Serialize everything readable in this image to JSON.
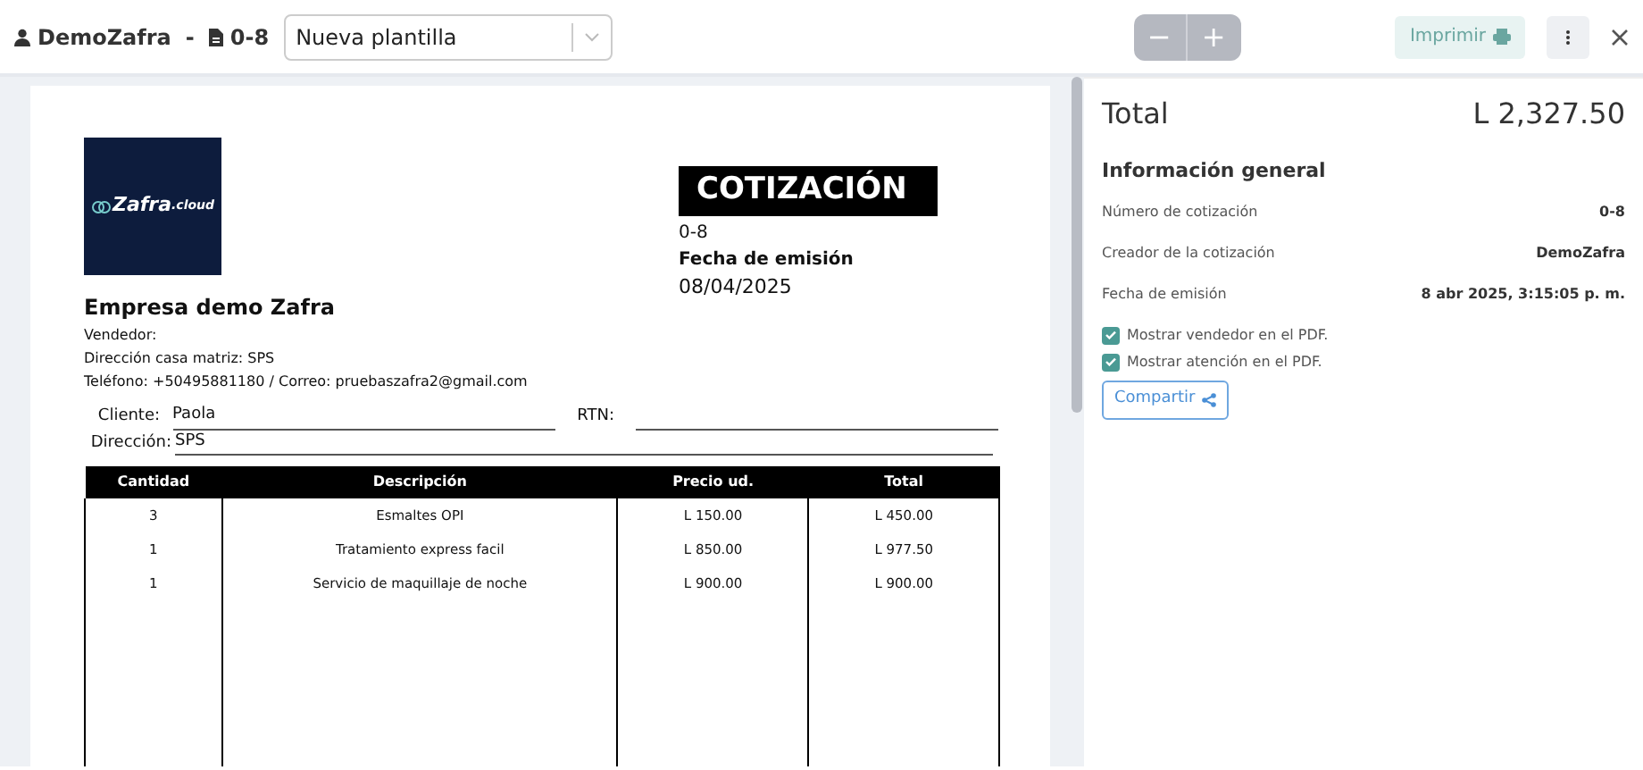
{
  "toolbar": {
    "user": "DemoZafra",
    "separator": "-",
    "document": "0-8",
    "template": "Nueva plantilla",
    "zoom_out": "−",
    "zoom_in": "+",
    "print": "Imprimir"
  },
  "document": {
    "title": "COTIZACIÓN",
    "number": "0-8",
    "date_label": "Fecha de emisión",
    "date": "08/04/2025",
    "logo_text": "Zafra",
    "logo_suffix": ".cloud",
    "company": "Empresa demo Zafra",
    "info_lines": [
      "Vendedor:",
      "Dirección casa matriz: SPS",
      "Teléfono: +50495881180 / Correo: pruebaszafra2@gmail.com"
    ],
    "client_label": "Cliente:",
    "client": "Paola",
    "rtn_label": "RTN:",
    "address_label": "Dirección:",
    "address": "SPS",
    "table": {
      "columns": [
        "Cantidad",
        "Descripción",
        "Precio ud.",
        "Total"
      ],
      "rows": [
        [
          "3",
          "Esmaltes OPI",
          "L 150.00",
          "L 450.00"
        ],
        [
          "1",
          "Tratamiento express facil",
          "L 850.00",
          "L 977.50"
        ],
        [
          "1",
          "Servicio de maquillaje de noche",
          "L 900.00",
          "L 900.00"
        ]
      ]
    }
  },
  "panel": {
    "total_label": "Total",
    "total": "L 2,327.50",
    "section_title": "Información general",
    "fields": [
      {
        "label": "Número de cotización",
        "value": "0-8"
      },
      {
        "label": "Creador de la cotización",
        "value": "DemoZafra"
      },
      {
        "label": "Fecha de emisión",
        "value": "8 abr 2025, 3:15:05 p. m."
      }
    ],
    "options": [
      {
        "label": "Mostrar vendedor en el PDF.",
        "checked": true
      },
      {
        "label": "Mostrar atención en el PDF.",
        "checked": true
      }
    ],
    "share": "Compartir"
  }
}
